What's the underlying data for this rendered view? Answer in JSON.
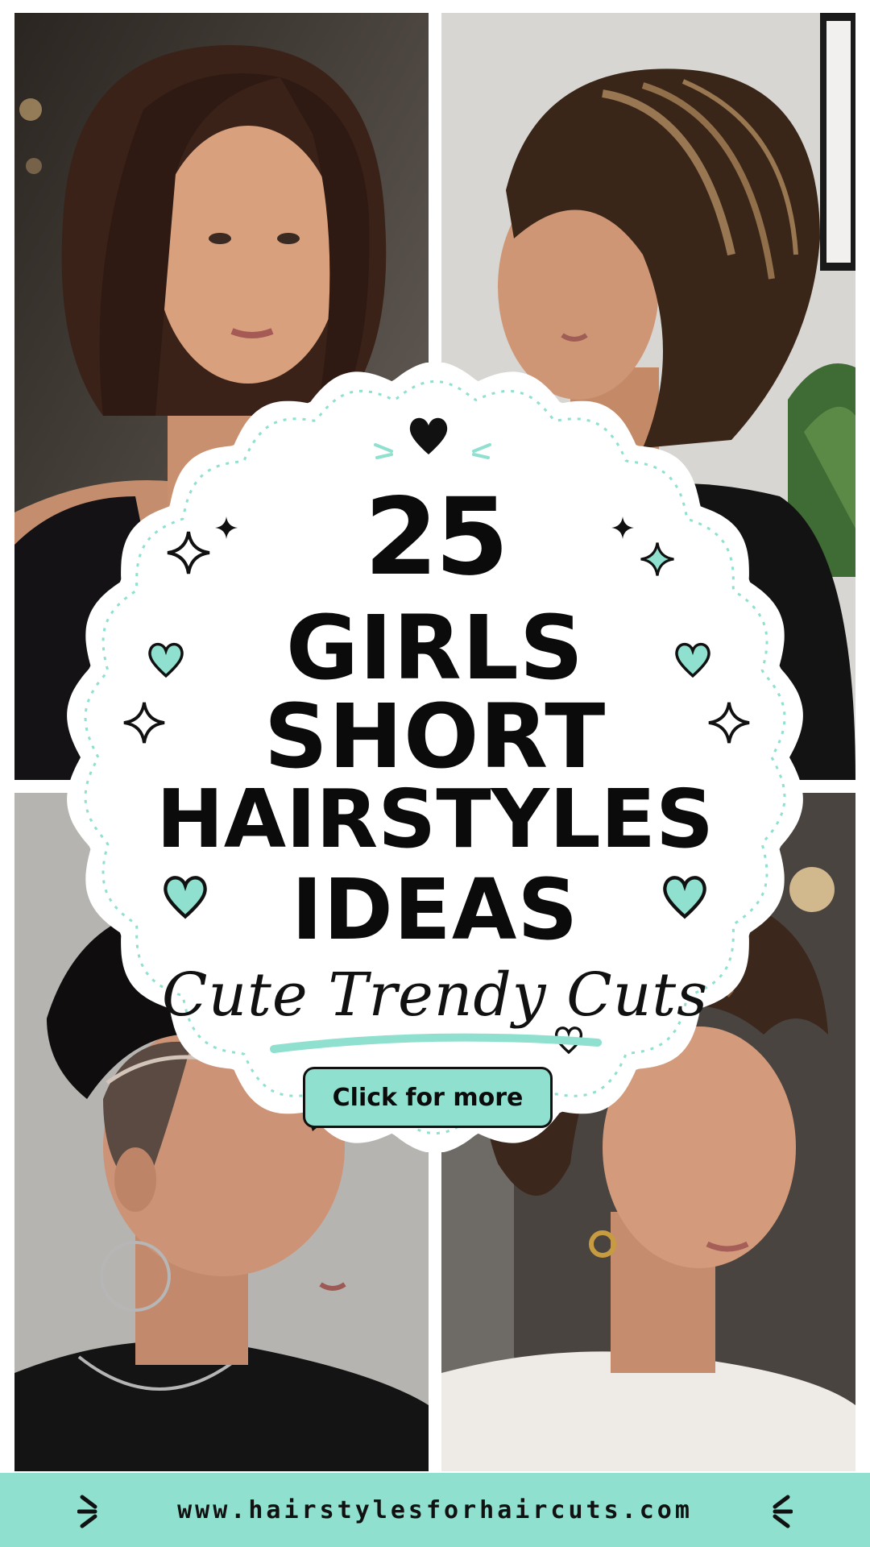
{
  "photos": [
    {
      "name": "sleek-brunette-bob-photo"
    },
    {
      "name": "highlighted-inverted-bob-photo"
    },
    {
      "name": "undercut-pixie-photo"
    },
    {
      "name": "shaggy-layered-pixie-photo"
    }
  ],
  "title": {
    "number": "25",
    "line2": "GIRLS",
    "line3": "SHORT",
    "line4": "HAIRSTYLES",
    "line5": "IDEAS"
  },
  "subtitle": "Cute Trendy Cuts",
  "cta_label": "Click for more",
  "footer_url": "www.hairstylesforhaircuts.com",
  "colors": {
    "accent": "#8fe0cf",
    "text": "#0b0b0b",
    "badge_bg": "#ffffff"
  },
  "icons": [
    "heart-icon",
    "sparkle-icon",
    "burst-icon"
  ]
}
